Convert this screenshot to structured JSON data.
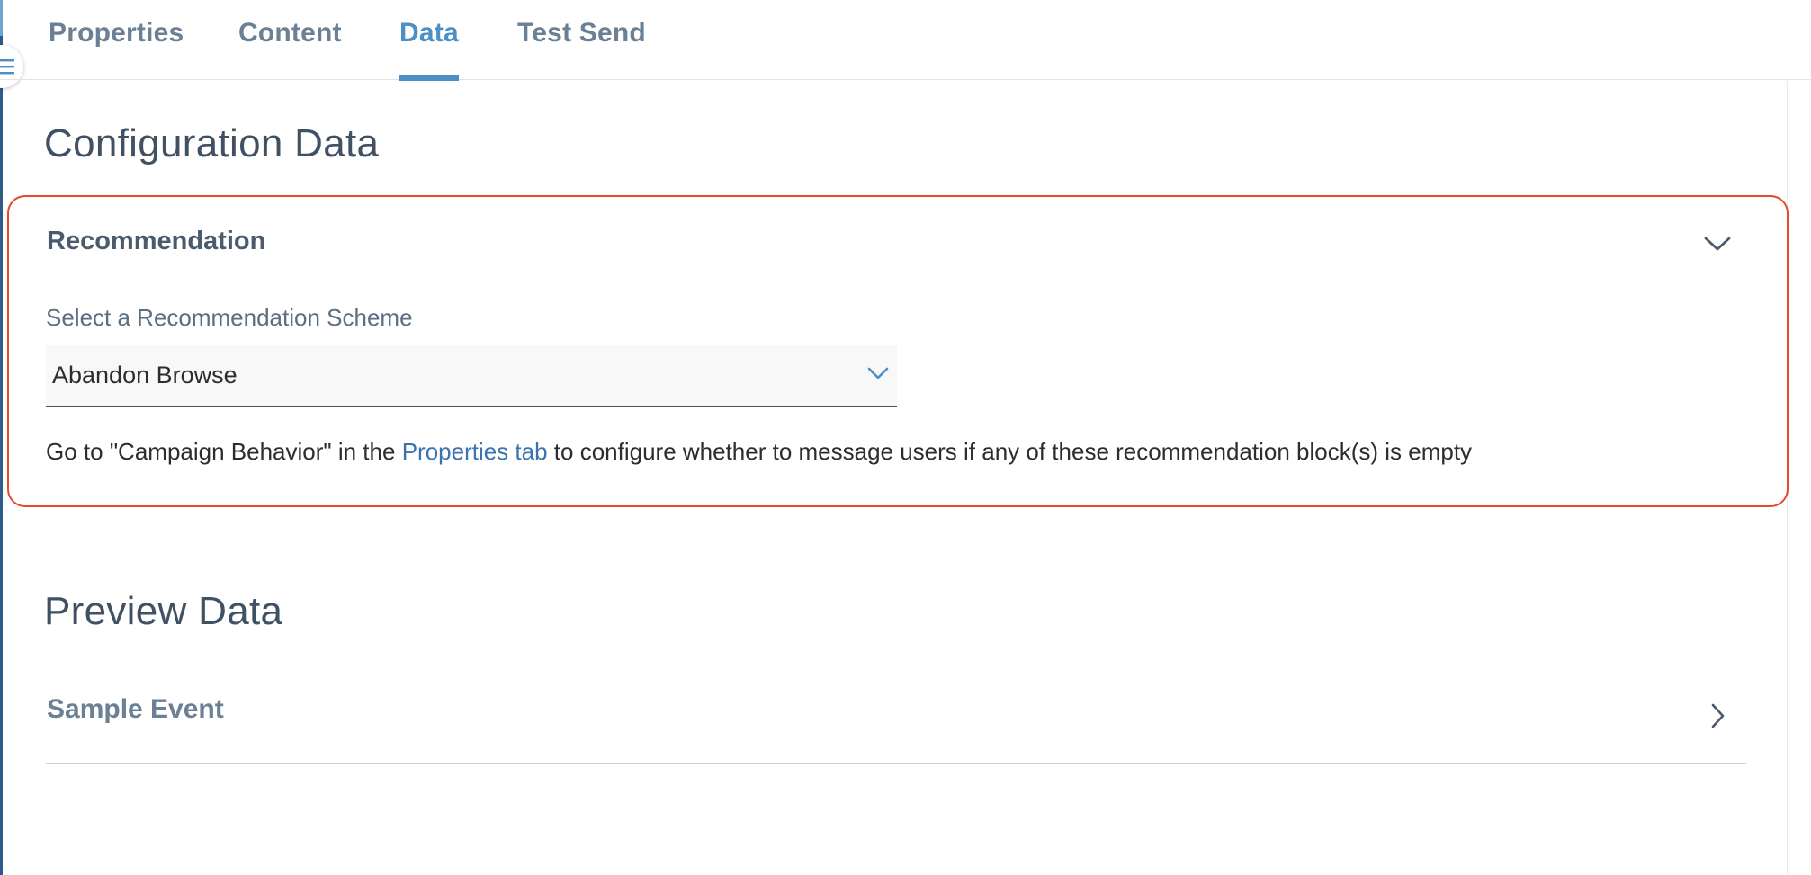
{
  "tabs": [
    {
      "label": "Properties",
      "active": false
    },
    {
      "label": "Content",
      "active": false
    },
    {
      "label": "Data",
      "active": true
    },
    {
      "label": "Test Send",
      "active": false
    }
  ],
  "config": {
    "title": "Configuration Data",
    "card": {
      "title": "Recommendation",
      "field_label": "Select a Recommendation Scheme",
      "selected_scheme": "Abandon Browse",
      "help_prefix": "Go to \"Campaign Behavior\" in the ",
      "help_link": "Properties tab",
      "help_suffix": " to configure whether to message users if any of these recommendation block(s) is empty"
    }
  },
  "preview": {
    "title": "Preview Data",
    "sample_event_label": "Sample Event"
  },
  "icons": {
    "sidebar_toggle": "menu-icon",
    "card_collapse": "chevron-down-icon",
    "select_dropdown": "chevron-down-icon",
    "sample_expand": "chevron-right-icon"
  },
  "colors": {
    "accent": "#4d8fc4",
    "highlight_border": "#e5492c",
    "tab_inactive": "#6b7f95",
    "heading": "#3f5163",
    "link": "#3c72ad"
  }
}
